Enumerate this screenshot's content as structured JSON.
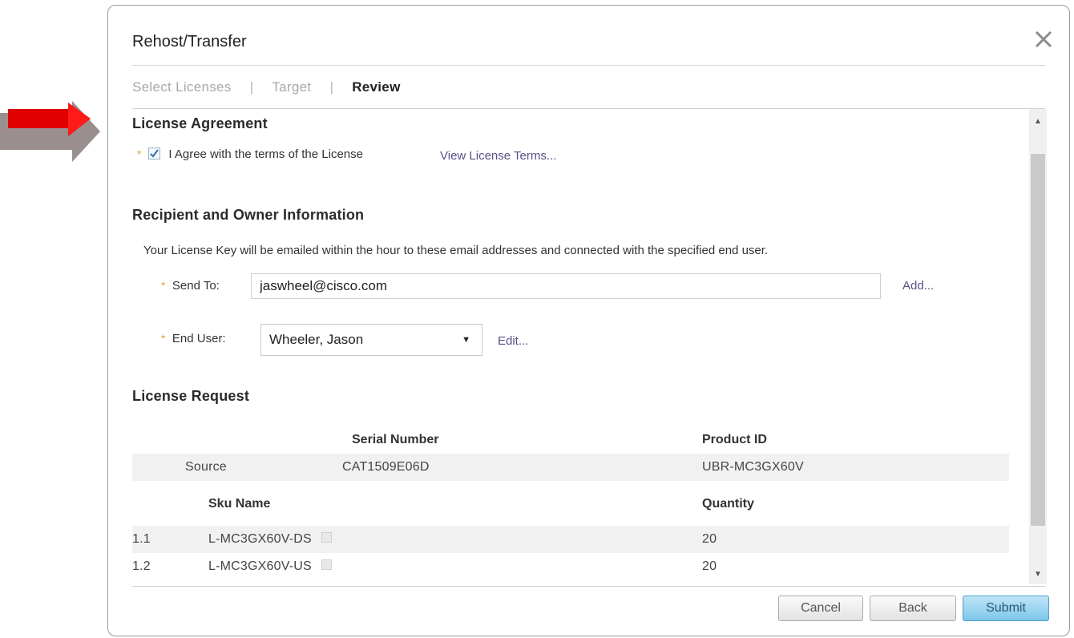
{
  "dialog": {
    "title": "Rehost/Transfer",
    "close_icon": "close-icon"
  },
  "steps": [
    {
      "label": "Select Licenses",
      "active": false
    },
    {
      "label": "Target",
      "active": false
    },
    {
      "label": "Review",
      "active": true
    }
  ],
  "steps_separator": "|",
  "agreement": {
    "section_title": "License Agreement",
    "checkbox_label": "I Agree with the terms of the License",
    "checked": true,
    "view_terms_link": "View License Terms..."
  },
  "recipient": {
    "section_title": "Recipient and Owner Information",
    "description": "Your License Key will be emailed within the hour to these email addresses and connected with the specified end user.",
    "send_to_label": "Send To:",
    "send_to_value": "jaswheel@cisco.com",
    "add_link": "Add...",
    "end_user_label": "End User:",
    "end_user_value": "Wheeler, Jason",
    "edit_link": "Edit..."
  },
  "license_request": {
    "section_title": "License Request",
    "headers": {
      "serial": "Serial Number",
      "product": "Product ID"
    },
    "source": {
      "label": "Source",
      "serial": "CAT1509E06D",
      "product": "UBR-MC3GX60V"
    },
    "sku_headers": {
      "name": "Sku Name",
      "quantity": "Quantity"
    },
    "skus": [
      {
        "index": "1.1",
        "name": "L-MC3GX60V-DS",
        "quantity": "20"
      },
      {
        "index": "1.2",
        "name": "L-MC3GX60V-US",
        "quantity": "20"
      }
    ]
  },
  "buttons": {
    "cancel": "Cancel",
    "back": "Back",
    "submit": "Submit"
  },
  "colors": {
    "required_star": "#e0a63a",
    "link": "#5a4f86",
    "submit_button": "#7cc6ea",
    "annotation_arrow": "#e00000"
  }
}
